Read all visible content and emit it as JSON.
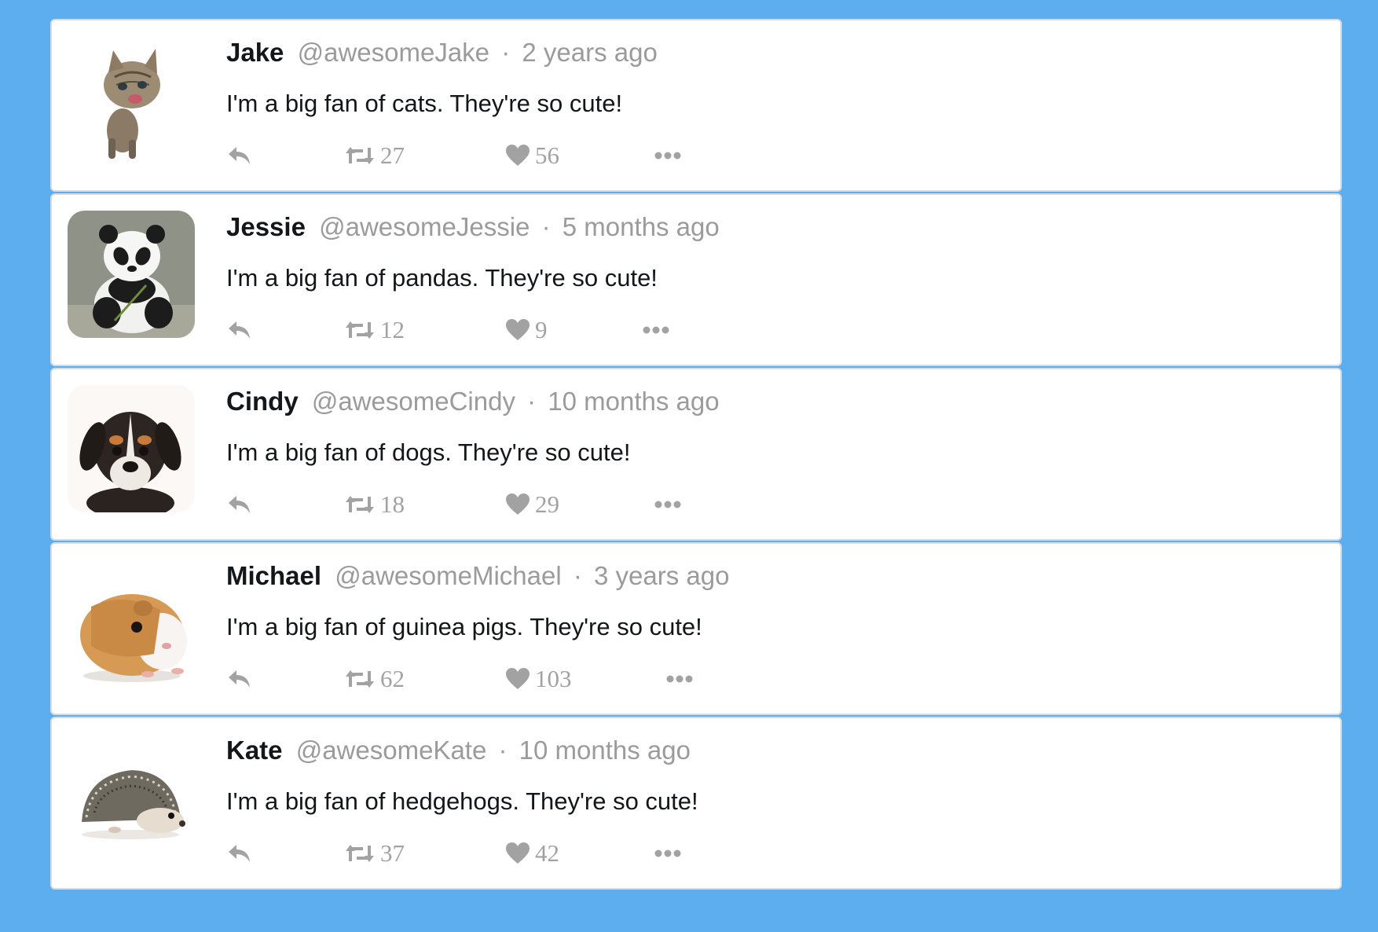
{
  "colors": {
    "background": "#5daeee",
    "card": "#ffffff",
    "name": "#14171a",
    "meta": "#9b9b9b",
    "action": "#a2a2a2"
  },
  "tweets": [
    {
      "name": "Jake",
      "handle": "@awesomeJake",
      "separator": "·",
      "time": "2 years ago",
      "text": "I'm a big fan of cats. They're so cute!",
      "retweets": "27",
      "likes": "56",
      "avatar": "kitten-avatar"
    },
    {
      "name": "Jessie",
      "handle": "@awesomeJessie",
      "separator": "·",
      "time": "5 months ago",
      "text": "I'm a big fan of pandas. They're so cute!",
      "retweets": "12",
      "likes": "9",
      "avatar": "panda-avatar"
    },
    {
      "name": "Cindy",
      "handle": "@awesomeCindy",
      "separator": "·",
      "time": "10 months ago",
      "text": "I'm a big fan of dogs. They're so cute!",
      "retweets": "18",
      "likes": "29",
      "avatar": "puppy-avatar"
    },
    {
      "name": "Michael",
      "handle": "@awesomeMichael",
      "separator": "·",
      "time": "3 years ago",
      "text": "I'm a big fan of guinea pigs. They're so cute!",
      "retweets": "62",
      "likes": "103",
      "avatar": "guinea-pig-avatar"
    },
    {
      "name": "Kate",
      "handle": "@awesomeKate",
      "separator": "·",
      "time": "10 months ago",
      "text": "I'm a big fan of hedgehogs. They're so cute!",
      "retweets": "37",
      "likes": "42",
      "avatar": "hedgehog-avatar"
    }
  ]
}
